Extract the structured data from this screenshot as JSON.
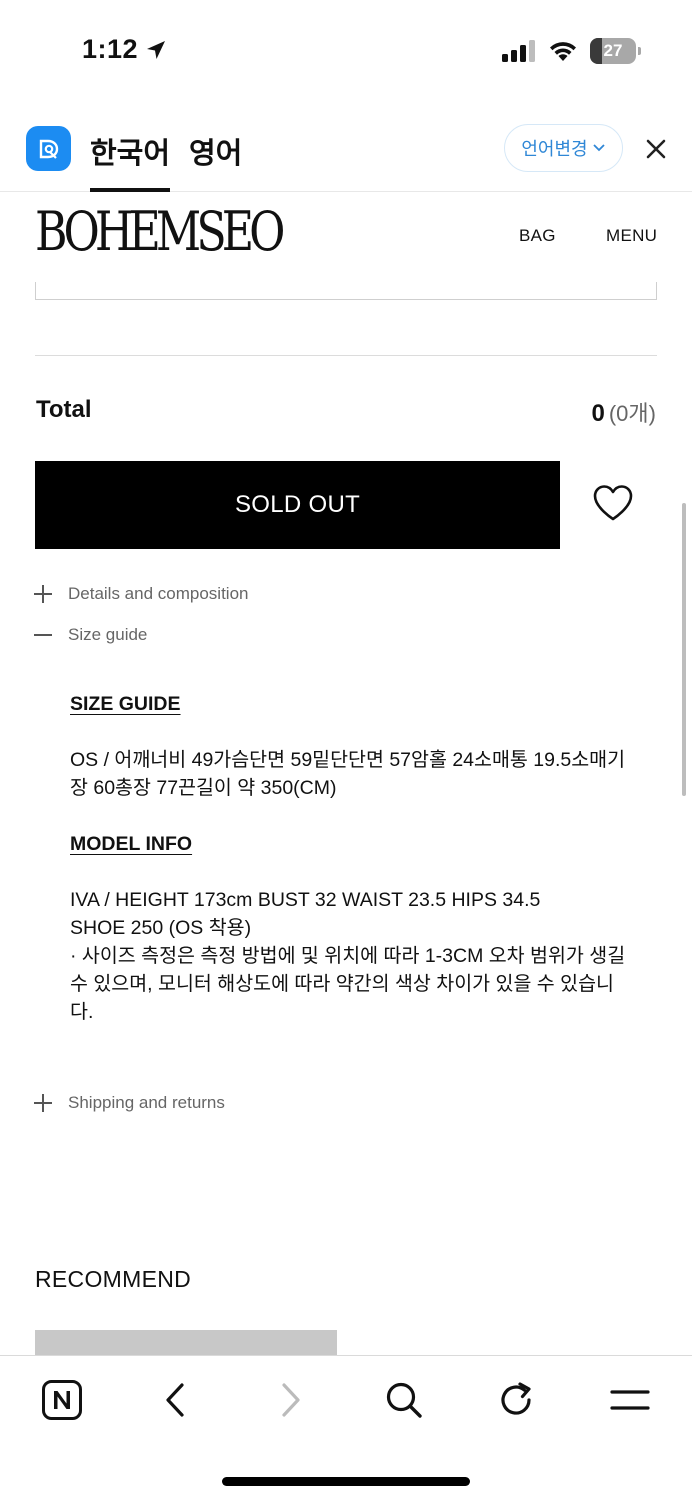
{
  "status_bar": {
    "time": "1:12",
    "battery": "27",
    "battery_level": 0.27
  },
  "translate_bar": {
    "tab_korean": "한국어",
    "tab_english": "영어",
    "active_tab": "한국어",
    "change_language": "언어변경"
  },
  "header": {
    "brand": "BOHEMSEO",
    "bag": "BAG",
    "menu": "MENU"
  },
  "total": {
    "label": "Total",
    "value": "0",
    "count": "(0개)"
  },
  "purchase": {
    "sold_out_label": "SOLD OUT"
  },
  "accordion": {
    "details": {
      "sign": "+",
      "label": "Details and composition"
    },
    "size_guide": {
      "sign": "—",
      "label": "Size guide"
    },
    "shipping": {
      "sign": "+",
      "label": "Shipping and returns"
    }
  },
  "size_guide": {
    "heading": "SIZE GUIDE",
    "measurements": "OS / 어깨너비 49가슴단면 59밑단단면 57암홀 24소매통 19.5소매기장 60총장 77끈길이 약 350(CM)",
    "model_heading": "MODEL INFO",
    "model_line1": "IVA / HEIGHT 173cm  BUST 32 WAIST 23.5 HIPS 34.5",
    "model_line2": "SHOE 250 (OS 착용)",
    "notice": "· 사이즈 측정은 측정 방법에 및 위치에 따라 1-3CM 오차 범위가 생길 수 있으며, 모니터 해상도에 따라 약간의 색상 차이가 있을 수 있습니다."
  },
  "recommend": {
    "title": "RECOMMEND"
  },
  "colors": {
    "accent_blue": "#1c8cf2",
    "link_blue": "#2f87d6",
    "button_black": "#000000"
  },
  "toolbar": {
    "items": [
      "naver-home-icon",
      "back-icon",
      "forward-icon",
      "search-icon",
      "refresh-icon",
      "menu-icon"
    ]
  }
}
